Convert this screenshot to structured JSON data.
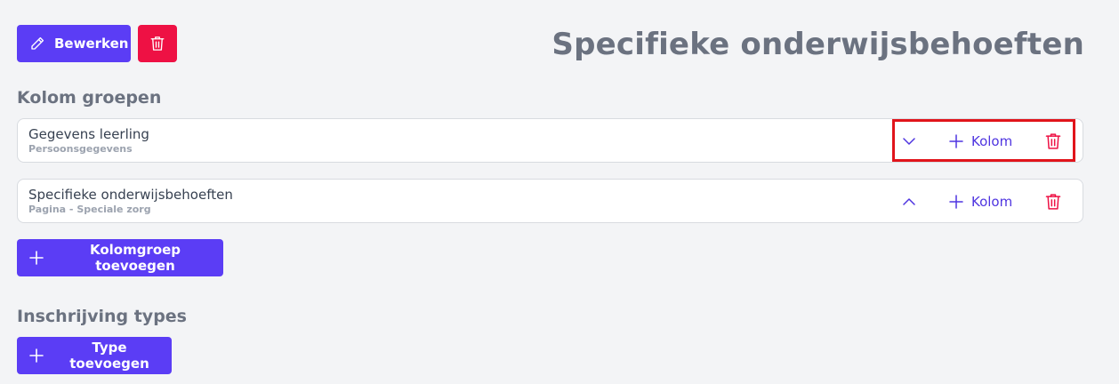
{
  "toolbar": {
    "edit_label": "Bewerken"
  },
  "page": {
    "title": "Specifieke onderwijsbehoeften"
  },
  "column_groups": {
    "heading": "Kolom groepen",
    "items": [
      {
        "name": "Gegevens leerling",
        "subtitle": "Persoonsgegevens",
        "add_label": "Kolom",
        "expanded": false
      },
      {
        "name": "Specifieke onderwijsbehoeften",
        "subtitle": "Pagina - Speciale zorg",
        "add_label": "Kolom",
        "expanded": true
      }
    ],
    "add_button_label": "Kolomgroep toevoegen"
  },
  "enrollment_types": {
    "heading": "Inschrijving types",
    "add_button_label": "Type toevoegen"
  },
  "colors": {
    "primary": "#5b3df5",
    "danger": "#ee1144",
    "highlight": "#e1141b",
    "text_muted": "#6b7280"
  },
  "icons": {
    "edit": "pencil-icon",
    "delete": "trash-icon",
    "collapse": "chevron-down-icon",
    "expand": "chevron-up-icon",
    "add": "plus-icon"
  }
}
